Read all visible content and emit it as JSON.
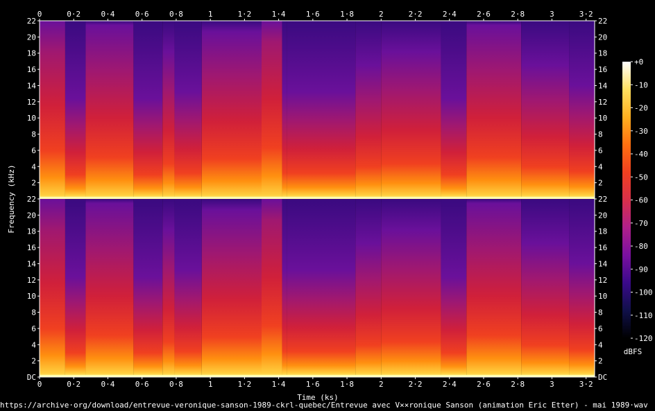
{
  "chart_data": {
    "type": "heatmap",
    "subtype": "spectrogram",
    "xlabel": "Time (ks)",
    "ylabel": "Frequency (kHz)",
    "x_ticks": [
      "0",
      "0·2",
      "0·4",
      "0·6",
      "0·8",
      "1",
      "1·2",
      "1·4",
      "1·6",
      "1·8",
      "2",
      "2·2",
      "2·4",
      "2·6",
      "2·8",
      "3",
      "3·2"
    ],
    "x_tick_values": [
      0,
      0.2,
      0.4,
      0.6,
      0.8,
      1.0,
      1.2,
      1.4,
      1.6,
      1.8,
      2.0,
      2.2,
      2.4,
      2.6,
      2.8,
      3.0,
      3.2
    ],
    "xlim": [
      0,
      3.25
    ],
    "channels": [
      {
        "y_ticks": [
          "2",
          "4",
          "6",
          "8",
          "10",
          "12",
          "14",
          "16",
          "18",
          "20",
          "22"
        ],
        "y_tick_values": [
          2,
          4,
          6,
          8,
          10,
          12,
          14,
          16,
          18,
          20,
          22
        ]
      },
      {
        "y_ticks": [
          "DC",
          "2",
          "4",
          "6",
          "8",
          "10",
          "12",
          "14",
          "16",
          "18",
          "20",
          "22"
        ],
        "y_tick_values": [
          0,
          2,
          4,
          6,
          8,
          10,
          12,
          14,
          16,
          18,
          20,
          22
        ]
      }
    ],
    "ylim": [
      0,
      22
    ],
    "colorbar": {
      "label": "dBFS",
      "ticks": [
        "+0",
        "-10",
        "-20",
        "-30",
        "-40",
        "-50",
        "-60",
        "-70",
        "-80",
        "-90",
        "-100",
        "-110",
        "-120"
      ],
      "tick_values": [
        0,
        -10,
        -20,
        -30,
        -40,
        -50,
        -60,
        -70,
        -80,
        -90,
        -100,
        -110,
        -120
      ],
      "range": [
        -120,
        0
      ],
      "colors": [
        "#000000",
        "#10104a",
        "#3a0a8a",
        "#7a10a0",
        "#b0208a",
        "#d8304a",
        "#f04020",
        "#ff7010",
        "#ffb020",
        "#ffe060",
        "#ffffff"
      ]
    },
    "segment_boundaries_ks": [
      0,
      0.15,
      0.27,
      0.55,
      0.72,
      0.79,
      0.95,
      1.3,
      1.42,
      1.45,
      1.85,
      2.0,
      2.35,
      2.5,
      2.82,
      3.1,
      3.25
    ]
  },
  "footer": {
    "source": "https://archive·org/download/entrevue-veronique-sanson-1989-ckrl-quebec/Entrevue avec V××ronique Sanson (animation Eric Etter) - mai 1989·wav"
  }
}
